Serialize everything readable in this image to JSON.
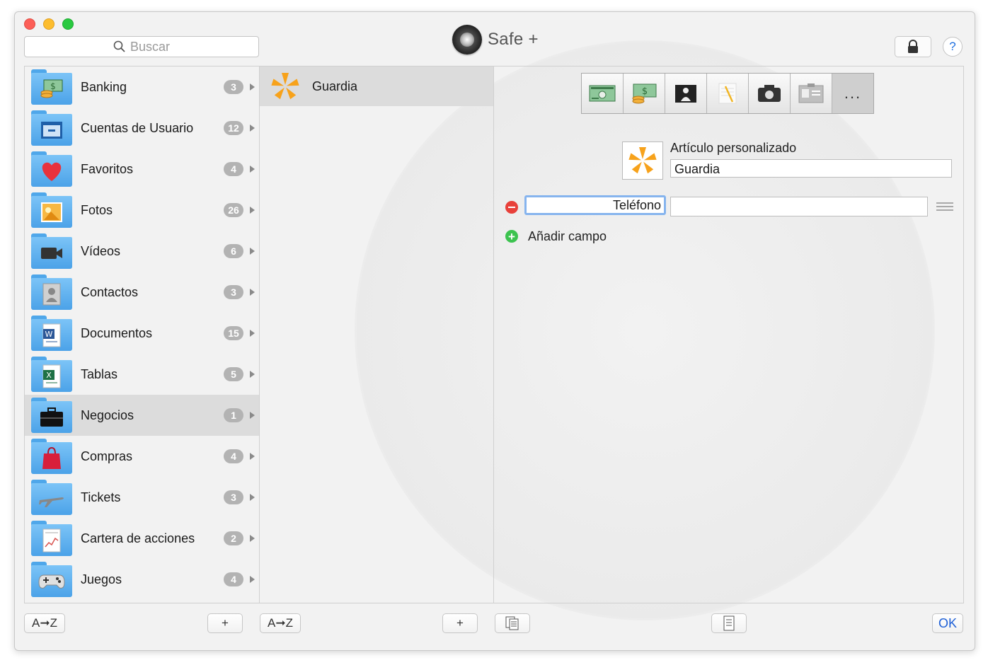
{
  "app": {
    "title": "Safe +"
  },
  "search": {
    "placeholder": "Buscar"
  },
  "categories": [
    {
      "label": "Banking",
      "count": "3",
      "icon": "money-icon"
    },
    {
      "label": "Cuentas de Usuario",
      "count": "12",
      "icon": "browser-window-icon"
    },
    {
      "label": "Favoritos",
      "count": "4",
      "icon": "heart-icon"
    },
    {
      "label": "Fotos",
      "count": "26",
      "icon": "photo-icon"
    },
    {
      "label": "Vídeos",
      "count": "6",
      "icon": "video-camera-icon"
    },
    {
      "label": "Contactos",
      "count": "3",
      "icon": "contact-card-icon"
    },
    {
      "label": "Documentos",
      "count": "15",
      "icon": "word-document-icon"
    },
    {
      "label": "Tablas",
      "count": "5",
      "icon": "spreadsheet-icon"
    },
    {
      "label": "Negocios",
      "count": "1",
      "icon": "briefcase-icon"
    },
    {
      "label": "Compras",
      "count": "4",
      "icon": "shopping-bag-icon"
    },
    {
      "label": "Tickets",
      "count": "3",
      "icon": "airplane-icon"
    },
    {
      "label": "Cartera de acciones",
      "count": "2",
      "icon": "stock-chart-icon"
    },
    {
      "label": "Juegos",
      "count": "4",
      "icon": "gamepad-icon"
    }
  ],
  "items": [
    {
      "label": "Guardia",
      "icon": "pinwheel-icon"
    }
  ],
  "detail": {
    "toolbar": [
      "credit-card-icon",
      "money-icon",
      "contact-icon",
      "note-icon",
      "camera-icon",
      "id-card-icon"
    ],
    "toolbar_more": "...",
    "type_label": "Artículo personalizado",
    "name_value": "Guardia",
    "fields": [
      {
        "label": "Teléfono",
        "value": ""
      }
    ],
    "add_field_label": "Añadir campo"
  },
  "bottom": {
    "sort_label": "A➞Z",
    "add_label": "+",
    "ok_label": "OK"
  },
  "colors": {
    "accent": "#1d5fd6",
    "folder": "#5aaeee",
    "selection": "#dcdcdc",
    "item_icon": "#f7a21b",
    "remove": "#e8403a",
    "add": "#3cc34f"
  }
}
